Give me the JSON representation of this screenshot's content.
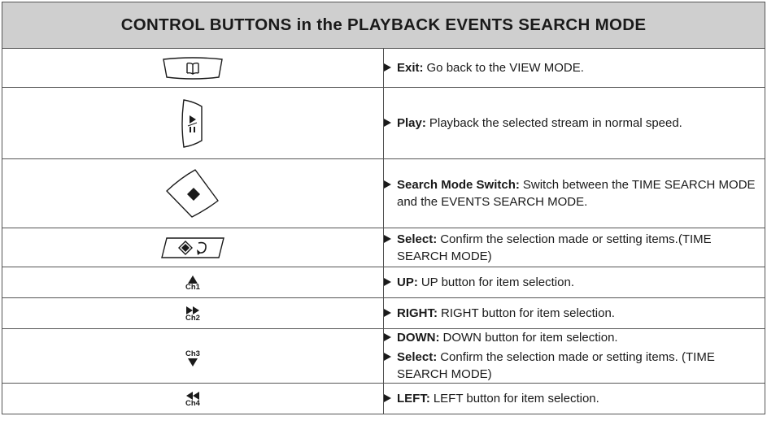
{
  "title": "CONTROL BUTTONS in the PLAYBACK EVENTS SEARCH MODE",
  "rows": [
    {
      "icon": "book-key-icon",
      "lines": [
        {
          "term": "Exit:",
          "text": "Go back to the VIEW MODE."
        }
      ]
    },
    {
      "icon": "play-pause-key-icon",
      "lines": [
        {
          "term": "Play:",
          "text": "Playback the selected stream in normal speed."
        }
      ]
    },
    {
      "icon": "diamond-key-icon",
      "lines": [
        {
          "term": "Search Mode Switch:",
          "text": "Switch between the TIME SEARCH MODE and the EVENTS SEARCH MODE."
        }
      ]
    },
    {
      "icon": "select-enter-key-icon",
      "lines": [
        {
          "term": "Select:",
          "text": "Confirm the selection made or setting items.(TIME SEARCH MODE)"
        }
      ]
    },
    {
      "icon": "up-arrow-ch1-icon",
      "label": "Ch1",
      "lines": [
        {
          "term": "UP:",
          "text": "UP button for item selection."
        }
      ]
    },
    {
      "icon": "fast-forward-ch2-icon",
      "label": "Ch2",
      "lines": [
        {
          "term": "RIGHT:",
          "text": "RIGHT button for item selection."
        }
      ]
    },
    {
      "icon": "down-arrow-ch3-icon",
      "label": "Ch3",
      "lines": [
        {
          "term": "DOWN:",
          "text": "DOWN button for item selection."
        },
        {
          "term": "Select:",
          "text": "Confirm the selection made or setting items. (TIME SEARCH MODE)"
        }
      ]
    },
    {
      "icon": "rewind-ch4-icon",
      "label": "Ch4",
      "lines": [
        {
          "term": "LEFT:",
          "text": "LEFT button for item selection."
        }
      ]
    }
  ]
}
